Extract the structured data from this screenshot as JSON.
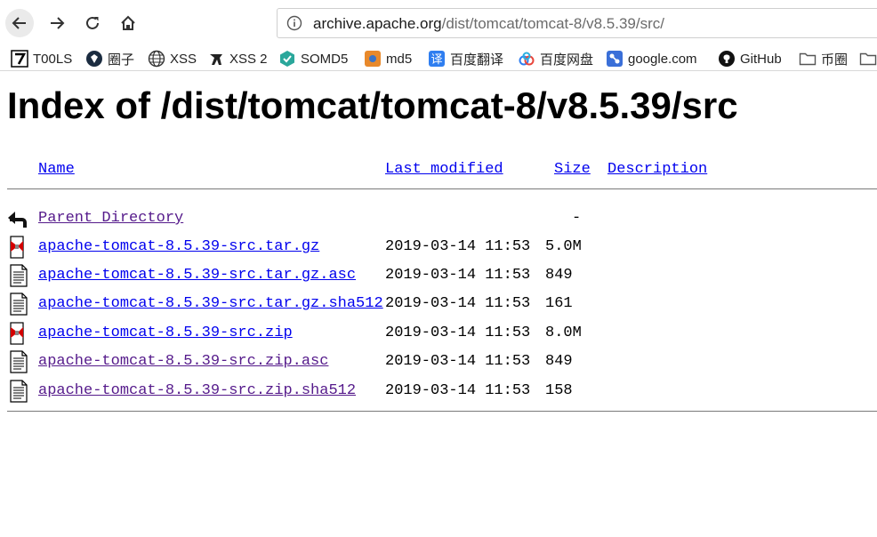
{
  "browser": {
    "url_host": "archive.apache.org",
    "url_path": "/dist/tomcat/tomcat-8/v8.5.39/src/"
  },
  "bookmarks": [
    {
      "label": "T00LS",
      "icon": "tools-icon"
    },
    {
      "label": "圈子",
      "icon": "circle-icon"
    },
    {
      "label": "XSS",
      "icon": "globe-icon"
    },
    {
      "label": "XSS 2",
      "icon": "xss2-icon"
    },
    {
      "label": "SOMD5",
      "icon": "somd5-icon"
    },
    {
      "label": "md5",
      "icon": "md5-icon"
    },
    {
      "label": "百度翻译",
      "icon": "baidu-translate-icon"
    },
    {
      "label": "百度网盘",
      "icon": "baidu-pan-icon"
    },
    {
      "label": "google.com",
      "icon": "google-icon"
    },
    {
      "label": "GitHub",
      "icon": "github-icon"
    },
    {
      "label": "币圈",
      "icon": "folder-icon"
    }
  ],
  "page": {
    "title": "Index of /dist/tomcat/tomcat-8/v8.5.39/src"
  },
  "listing": {
    "headers": {
      "name": "Name",
      "modified": "Last modified",
      "size": "Size",
      "description": "Description"
    },
    "parent": {
      "name": "Parent Directory",
      "size": "-"
    },
    "rows": [
      {
        "name": "apache-tomcat-8.5.39-src.tar.gz",
        "modified": "2019-03-14 11:53",
        "size": "5.0M",
        "icon": "compressed-file-icon",
        "visited": false
      },
      {
        "name": "apache-tomcat-8.5.39-src.tar.gz.asc",
        "modified": "2019-03-14 11:53",
        "size": "849",
        "icon": "text-file-icon",
        "visited": false
      },
      {
        "name": "apache-tomcat-8.5.39-src.tar.gz.sha512",
        "modified": "2019-03-14 11:53",
        "size": "161",
        "icon": "text-file-icon",
        "visited": false
      },
      {
        "name": "apache-tomcat-8.5.39-src.zip",
        "modified": "2019-03-14 11:53",
        "size": "8.0M",
        "icon": "compressed-file-icon",
        "visited": false
      },
      {
        "name": "apache-tomcat-8.5.39-src.zip.asc",
        "modified": "2019-03-14 11:53",
        "size": "849",
        "icon": "text-file-icon",
        "visited": true
      },
      {
        "name": "apache-tomcat-8.5.39-src.zip.sha512",
        "modified": "2019-03-14 11:53",
        "size": "158",
        "icon": "text-file-icon",
        "visited": true
      }
    ]
  }
}
